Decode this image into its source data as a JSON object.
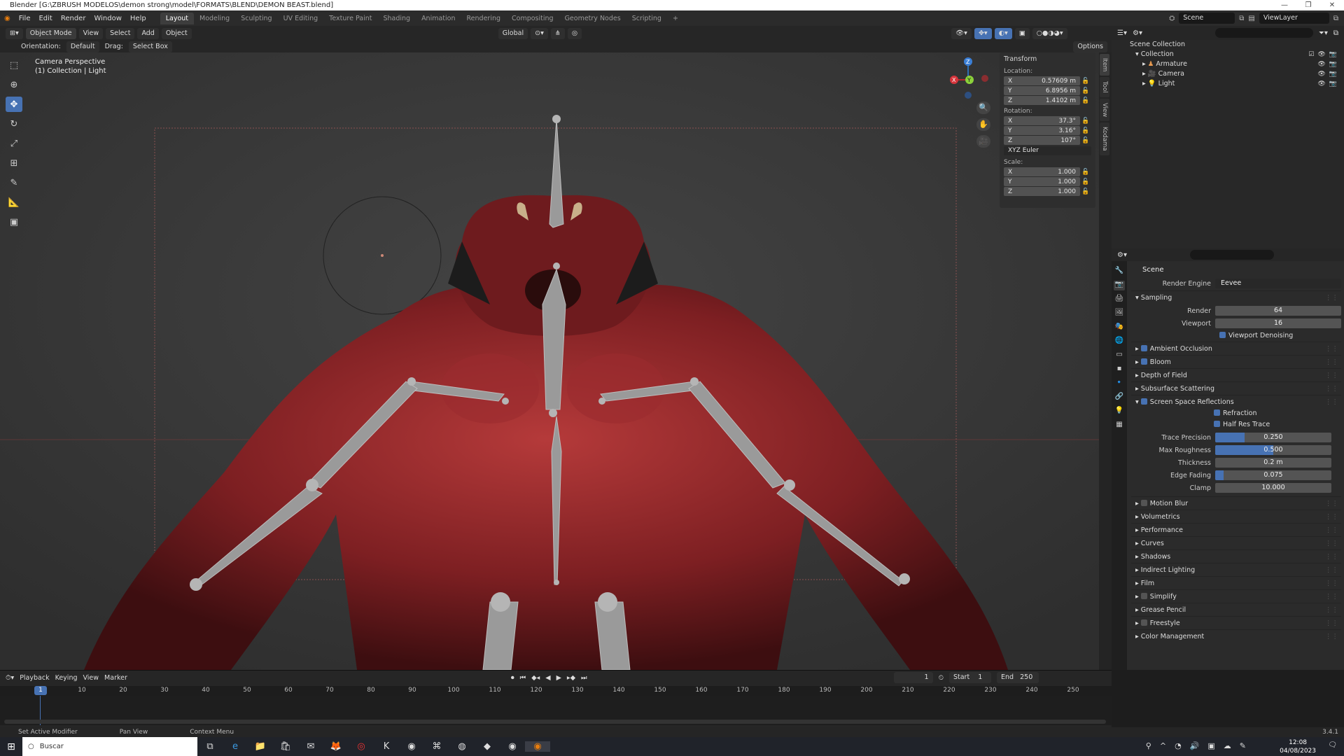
{
  "window": {
    "title": "Blender [G:\\ZBRUSH MODELOS\\demon strong\\model\\FORMATS\\BLEND\\DEMON BEAST.blend]"
  },
  "menu": [
    "File",
    "Edit",
    "Render",
    "Window",
    "Help"
  ],
  "workspaces": [
    "Layout",
    "Modeling",
    "Sculpting",
    "UV Editing",
    "Texture Paint",
    "Shading",
    "Animation",
    "Rendering",
    "Compositing",
    "Geometry Nodes",
    "Scripting"
  ],
  "scene_name": "Scene",
  "view_layer": "ViewLayer",
  "toolbar": {
    "mode": "Object Mode",
    "view": "View",
    "select": "Select",
    "add": "Add",
    "object": "Object",
    "transform": "Global",
    "options": "Options"
  },
  "header2": {
    "orientation_label": "Orientation:",
    "orientation": "Default",
    "drag_label": "Drag:",
    "drag": "Select Box"
  },
  "viewport": {
    "camera": "Camera Perspective",
    "context": "(1) Collection | Light"
  },
  "transform": {
    "title": "Transform",
    "location_label": "Location:",
    "rotation_label": "Rotation:",
    "scale_label": "Scale:",
    "location": [
      {
        "axis": "X",
        "value": "0.57609 m"
      },
      {
        "axis": "Y",
        "value": "6.8956 m"
      },
      {
        "axis": "Z",
        "value": "1.4102 m"
      }
    ],
    "rotation": [
      {
        "axis": "X",
        "value": "37.3°"
      },
      {
        "axis": "Y",
        "value": "3.16°"
      },
      {
        "axis": "Z",
        "value": "107°"
      }
    ],
    "rotation_mode": "XYZ Euler",
    "scale": [
      {
        "axis": "X",
        "value": "1.000"
      },
      {
        "axis": "Y",
        "value": "1.000"
      },
      {
        "axis": "Z",
        "value": "1.000"
      }
    ]
  },
  "side_tabs": [
    "Item",
    "Tool",
    "View",
    "Kodama"
  ],
  "outliner": {
    "root": "Scene Collection",
    "collection": "Collection",
    "items": [
      "Armature",
      "Camera",
      "Light"
    ]
  },
  "properties": {
    "scene": "Scene",
    "render_engine_label": "Render Engine",
    "render_engine": "Eevee",
    "sampling": {
      "title": "Sampling",
      "render_label": "Render",
      "render": "64",
      "viewport_label": "Viewport",
      "viewport": "16",
      "denoise": "Viewport Denoising"
    },
    "sections_a": [
      {
        "label": "Ambient Occlusion",
        "check": "on"
      },
      {
        "label": "Bloom",
        "check": "on"
      },
      {
        "label": "Depth of Field"
      },
      {
        "label": "Subsurface Scattering"
      },
      {
        "label": "Screen Space Reflections",
        "check": "on"
      }
    ],
    "ssr": {
      "refraction": "Refraction",
      "half_res": "Half Res Trace",
      "fields": [
        {
          "label": "Trace Precision",
          "value": "0.250",
          "fill": 0.25
        },
        {
          "label": "Max Roughness",
          "value": "0.500",
          "fill": 0.5
        },
        {
          "label": "Thickness",
          "value": "0.2 m",
          "fill": 0
        },
        {
          "label": "Edge Fading",
          "value": "0.075",
          "fill": 0.075
        },
        {
          "label": "Clamp",
          "value": "10.000",
          "fill": 0
        }
      ]
    },
    "sections_b": [
      {
        "label": "Motion Blur",
        "check": "off"
      },
      {
        "label": "Volumetrics"
      },
      {
        "label": "Performance"
      },
      {
        "label": "Curves"
      },
      {
        "label": "Shadows"
      },
      {
        "label": "Indirect Lighting"
      },
      {
        "label": "Film"
      },
      {
        "label": "Simplify",
        "check": "off"
      },
      {
        "label": "Grease Pencil"
      },
      {
        "label": "Freestyle",
        "check": "off"
      },
      {
        "label": "Color Management"
      }
    ]
  },
  "timeline": {
    "playback": "Playback",
    "keying": "Keying",
    "view": "View",
    "marker": "Marker",
    "current": "1",
    "start_label": "Start",
    "start": "1",
    "end_label": "End",
    "end": "250",
    "ticks": [
      "10",
      "20",
      "30",
      "40",
      "50",
      "60",
      "70",
      "80",
      "90",
      "100",
      "110",
      "120",
      "130",
      "140",
      "150",
      "160",
      "170",
      "180",
      "190",
      "200",
      "210",
      "220",
      "230",
      "240",
      "250"
    ]
  },
  "status": {
    "left": "Set Active Modifier",
    "mid": "Pan View",
    "right": "Context Menu",
    "version": "3.4.1"
  },
  "taskbar": {
    "search": "Buscar",
    "time": "12:08",
    "date": "04/08/2023"
  }
}
